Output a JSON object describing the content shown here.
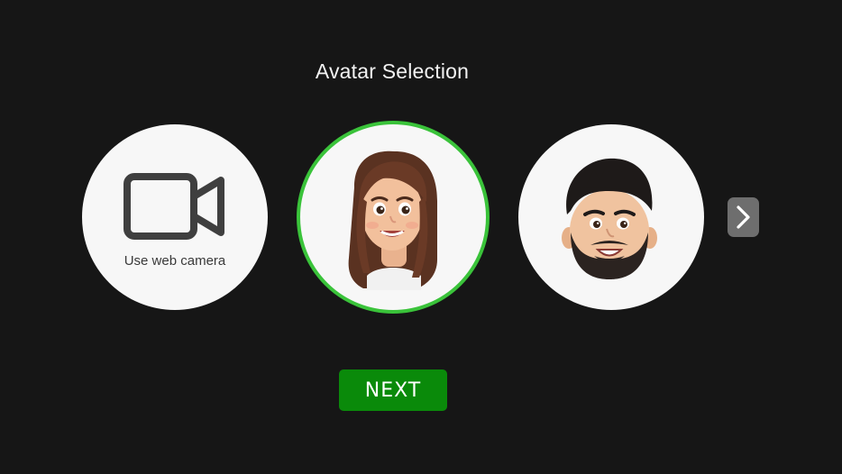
{
  "page": {
    "title": "Avatar Selection"
  },
  "options": {
    "webcam": {
      "label": "Use web camera",
      "icon": "video-camera-icon"
    },
    "avatar_female": {
      "icon": "female-memoji-avatar",
      "selected": true
    },
    "avatar_male": {
      "icon": "male-memoji-avatar",
      "selected": false
    }
  },
  "carousel": {
    "next_icon": "chevron-right-icon"
  },
  "actions": {
    "next_label": "NEXT"
  },
  "colors": {
    "background": "#161616",
    "selection_ring": "#3ac33a",
    "primary_button": "#0a8a0a",
    "circle_fill": "#f7f7f7",
    "arrow_button": "#6e6e6e"
  }
}
